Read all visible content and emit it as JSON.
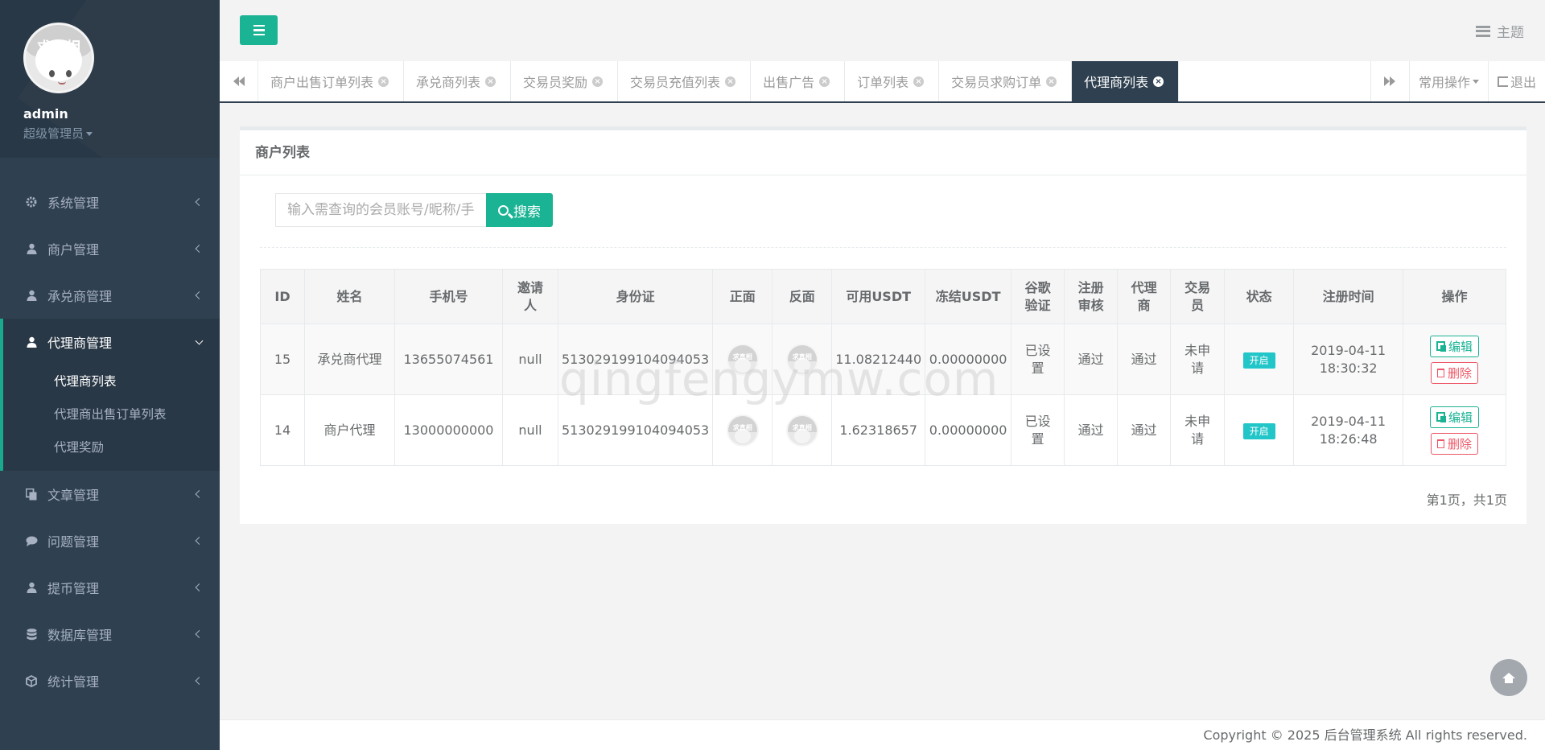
{
  "profile": {
    "avatar_text": "求真相",
    "name": "admin",
    "role": "超级管理员"
  },
  "nav": [
    {
      "label": "系统管理",
      "icon": "gear-icon"
    },
    {
      "label": "商户管理",
      "icon": "user-icon"
    },
    {
      "label": "承兑商管理",
      "icon": "user-icon"
    },
    {
      "label": "代理商管理",
      "icon": "user-icon",
      "active": true,
      "children": [
        "代理商列表",
        "代理商出售订单列表",
        "代理奖励"
      ]
    },
    {
      "label": "文章管理",
      "icon": "copy-icon"
    },
    {
      "label": "问题管理",
      "icon": "comment-icon"
    },
    {
      "label": "提币管理",
      "icon": "user-icon"
    },
    {
      "label": "数据库管理",
      "icon": "database-icon"
    },
    {
      "label": "统计管理",
      "icon": "cube-icon"
    }
  ],
  "header": {
    "theme_label": "主题"
  },
  "tabs": [
    {
      "label": "商户出售订单列表"
    },
    {
      "label": "承兑商列表"
    },
    {
      "label": "交易员奖励"
    },
    {
      "label": "交易员充值列表"
    },
    {
      "label": "出售广告"
    },
    {
      "label": "订单列表"
    },
    {
      "label": "交易员求购订单"
    },
    {
      "label": "代理商列表",
      "active": true
    }
  ],
  "tab_actions": {
    "common_ops": "常用操作",
    "logout": "退出"
  },
  "panel": {
    "title": "商户列表",
    "search_placeholder": "输入需查询的会员账号/昵称/手机号",
    "search_button": "搜索"
  },
  "table": {
    "headers": [
      "ID",
      "姓名",
      "手机号",
      "邀请人",
      "身份证",
      "正面",
      "反面",
      "可用USDT",
      "冻结USDT",
      "谷歌验证",
      "注册审核",
      "代理商",
      "交易员",
      "状态",
      "注册时间",
      "操作"
    ],
    "rows": [
      {
        "id": "15",
        "name": "承兑商代理",
        "phone": "13655074561",
        "inviter": "null",
        "id_card": "513029199104094053",
        "available": "11.08212440",
        "frozen": "0.00000000",
        "google": "已设置",
        "review": "通过",
        "agent": "通过",
        "trader": "未申请",
        "status": "开启",
        "date": "2019-04-11",
        "time": "18:30:32"
      },
      {
        "id": "14",
        "name": "商户代理",
        "phone": "13000000000",
        "inviter": "null",
        "id_card": "513029199104094053",
        "available": "1.62318657",
        "frozen": "0.00000000",
        "google": "已设置",
        "review": "通过",
        "agent": "通过",
        "trader": "未申请",
        "status": "开启",
        "date": "2019-04-11",
        "time": "18:26:48"
      }
    ],
    "edit_label": "编辑",
    "delete_label": "删除",
    "avatar_text": "求真相"
  },
  "pager": "第1页，共1页",
  "watermark": "qingfengymw.com",
  "footer": "Copyright © 2025 后台管理系统 All rights reserved.",
  "colors": {
    "sidebar": "#2f4050",
    "accent": "#1ab394",
    "badge": "#23c6c8",
    "danger": "#ed5565"
  }
}
